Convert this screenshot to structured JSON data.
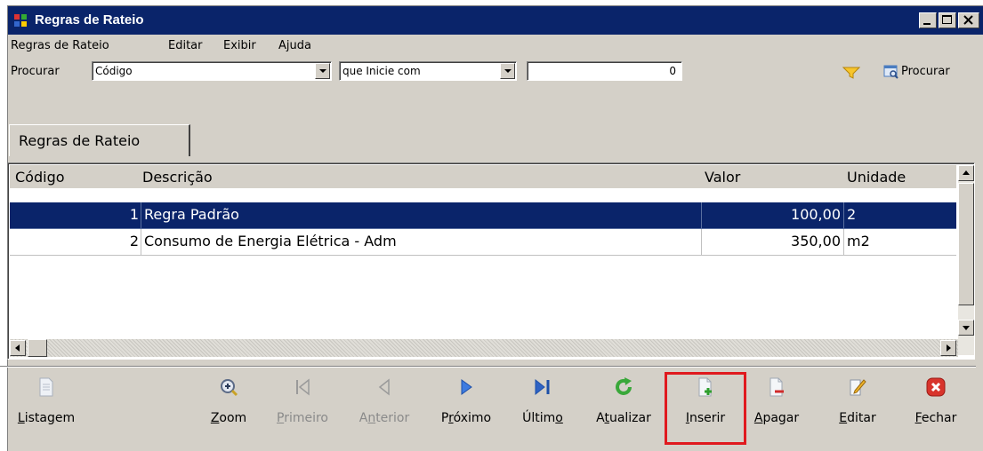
{
  "window": {
    "title": "Regras de Rateio"
  },
  "menu": [
    "Regras de Rateio",
    "Editar",
    "Exibir",
    "Ajuda"
  ],
  "search": {
    "label": "Procurar",
    "field": "Código",
    "condition": "que Inicie com",
    "value": "0",
    "button_label": "Procurar"
  },
  "tab": {
    "label": "Regras de Rateio"
  },
  "table": {
    "columns": [
      "Código",
      "Descrição",
      "Valor",
      "Unidade"
    ],
    "rows": [
      {
        "code": "1",
        "description": "Regra Padrão",
        "value": "100,00",
        "unit": "2",
        "selected": true
      },
      {
        "code": "2",
        "description": "Consumo de Energia Elétrica - Adm",
        "value": "350,00",
        "unit": "m2",
        "selected": false
      }
    ]
  },
  "toolbar": {
    "listagem": {
      "pre": "",
      "u": "L",
      "post": "istagem",
      "icon": "document-icon",
      "enabled": true
    },
    "zoom": {
      "pre": "",
      "u": "Z",
      "post": "oom",
      "icon": "zoom-icon",
      "enabled": true
    },
    "primeiro": {
      "pre": "",
      "u": "P",
      "post": "rimeiro",
      "icon": "first-icon",
      "enabled": false
    },
    "anterior": {
      "pre": "A",
      "u": "n",
      "post": "terior",
      "icon": "previous-icon",
      "enabled": false
    },
    "proximo": {
      "pre": "P",
      "u": "r",
      "post": "óximo",
      "icon": "next-icon",
      "enabled": true
    },
    "ultimo": {
      "pre": "Últim",
      "u": "o",
      "post": "",
      "icon": "last-icon",
      "enabled": true
    },
    "atualizar": {
      "pre": "A",
      "u": "t",
      "post": "ualizar",
      "icon": "refresh-icon",
      "enabled": true
    },
    "inserir": {
      "pre": "",
      "u": "I",
      "post": "nserir",
      "icon": "insert-icon",
      "enabled": true
    },
    "apagar": {
      "pre": "",
      "u": "A",
      "post": "pagar",
      "icon": "delete-icon",
      "enabled": true
    },
    "editar": {
      "pre": "",
      "u": "E",
      "post": "ditar",
      "icon": "edit-icon",
      "enabled": true
    },
    "fechar": {
      "pre": "",
      "u": "F",
      "post": "echar",
      "icon": "close-icon",
      "enabled": true
    }
  },
  "colors": {
    "titlebar": "#0a246a",
    "selection": "#0a246a",
    "highlight": "#e0191e",
    "face": "#d4d0c8"
  }
}
